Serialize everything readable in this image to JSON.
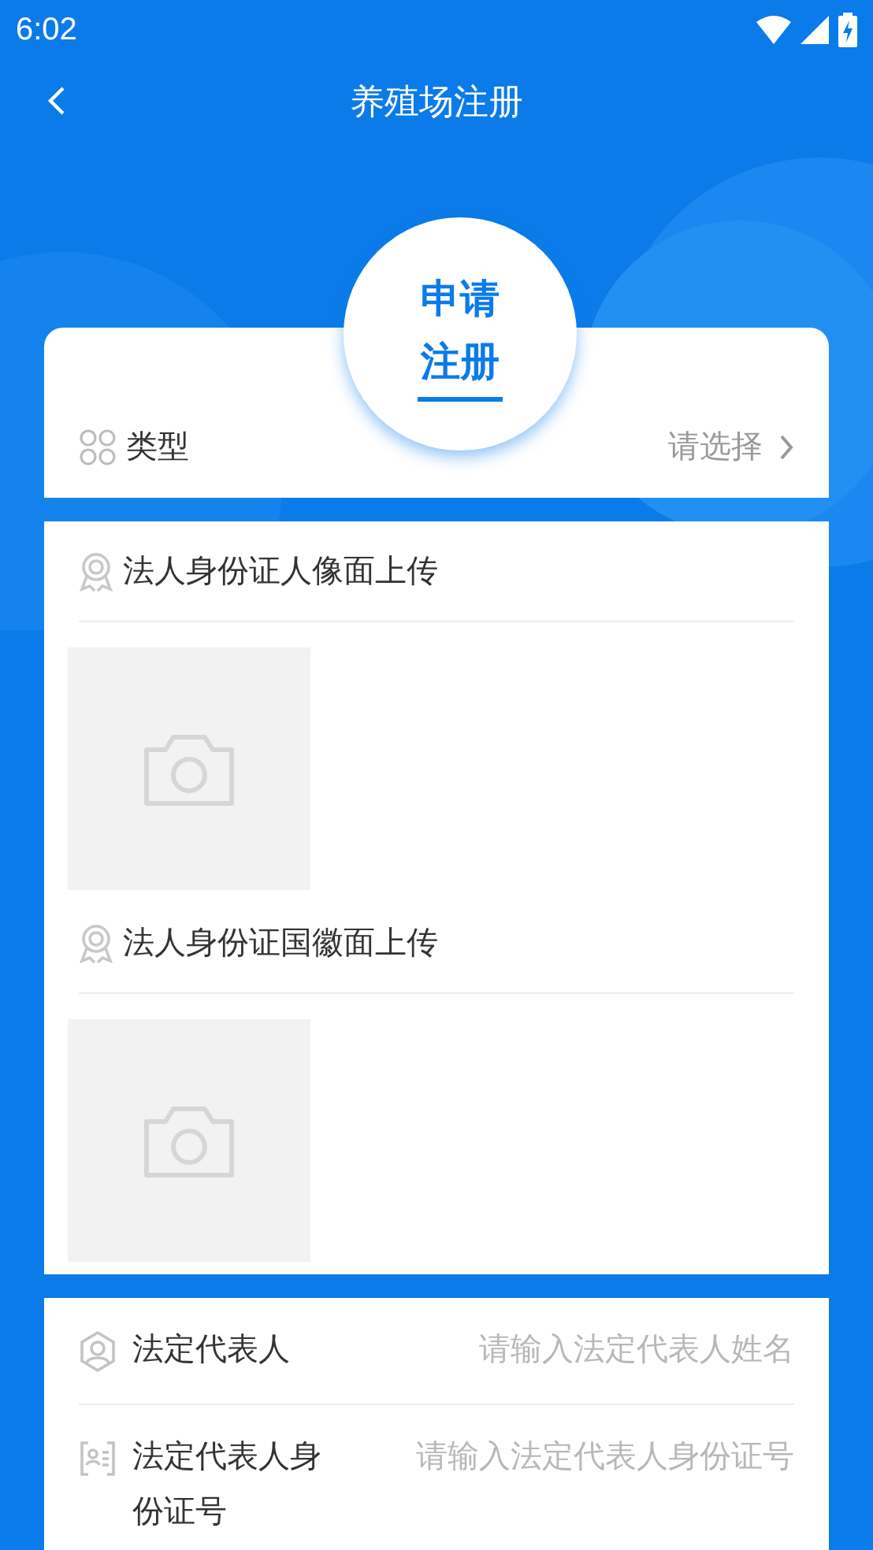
{
  "status_bar": {
    "time": "6:02"
  },
  "header": {
    "title": "养殖场注册"
  },
  "badge": {
    "lines": [
      "申请",
      "注册"
    ]
  },
  "type_row": {
    "label": "类型",
    "value": "请选择"
  },
  "uploads": [
    {
      "label": "法人身份证人像面上传"
    },
    {
      "label": "法人身份证国徽面上传"
    }
  ],
  "fields": [
    {
      "kind": "person",
      "label": "法定代表人",
      "placeholder": "请输入法定代表人姓名"
    },
    {
      "kind": "id-card",
      "label": "法定代表人身份证号",
      "placeholder": "请输入法定代表人身份证号"
    }
  ]
}
